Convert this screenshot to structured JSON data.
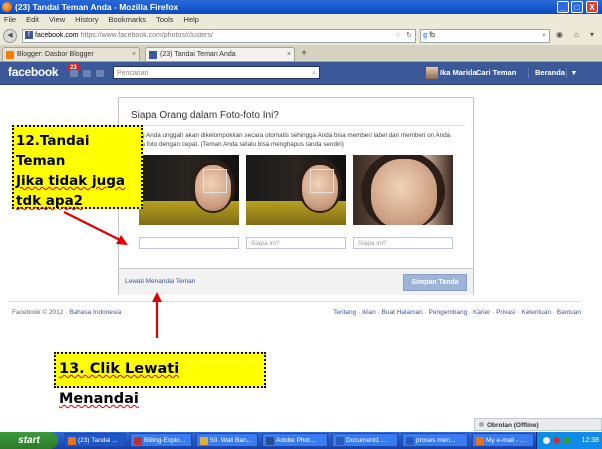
{
  "window": {
    "title": "(23) Tandai Teman Anda - Mozilla Firefox",
    "minimize": "_",
    "maximize": "□",
    "close": "X"
  },
  "menubar": [
    "File",
    "Edit",
    "View",
    "History",
    "Bookmarks",
    "Tools",
    "Help"
  ],
  "nav": {
    "url_host": "facebook.com",
    "url_path": "https://www.facebook.com/photos/clusters/",
    "search_value": "fb"
  },
  "tabs": [
    {
      "label": "Blogger: Dasbor Blogger",
      "active": false
    },
    {
      "label": "(23) Tandai Teman Anda",
      "active": true
    }
  ],
  "new_tab": "+",
  "facebook": {
    "logo": "facebook",
    "notification_count": "23",
    "search_placeholder": "Pencarian",
    "profile_name": "Ika Marida",
    "find_friends": "Cari Teman",
    "home": "Beranda"
  },
  "dialog": {
    "title": "Siapa Orang dalam Foto-foto Ini?",
    "description": "yang Anda unggah akan dikelompokkan secara otomatis sehingga Anda bisa memberi label dan memberi on Anda pada foto dengan cepat. (Teman Anda selalu bisa menghapus tanda sendiri)",
    "tag_inputs": [
      "",
      "Siapa ini?",
      "Siapa ini?"
    ],
    "skip_link": "Lewati Menandai Teman",
    "save_button": "Simpan Tanda"
  },
  "footer": {
    "copyright": "Facebook © 2012 · ",
    "language": "Bahasa Indonesia",
    "links": "Tentang · Iklan · Buat Halaman · Pengembang · Karier · Privasi · Ketentuan · Bantuan"
  },
  "callouts": {
    "step12_line1": "12.Tandai Teman",
    "step12_line2": "Jika tidak juga",
    "step12_line3": "tdk apa2",
    "step13": "13. Clik Lewati Menandai"
  },
  "chat": {
    "label": "Obrolan (Offline)"
  },
  "taskbar": {
    "start": "start",
    "tasks": [
      "(23) Tandai ...",
      "Billing-Explo...",
      "50. Wali Ban...",
      "Adobe Phot...",
      "Document1 ...",
      "proses men...",
      "My e-mail - ..."
    ],
    "time": "12:38"
  }
}
